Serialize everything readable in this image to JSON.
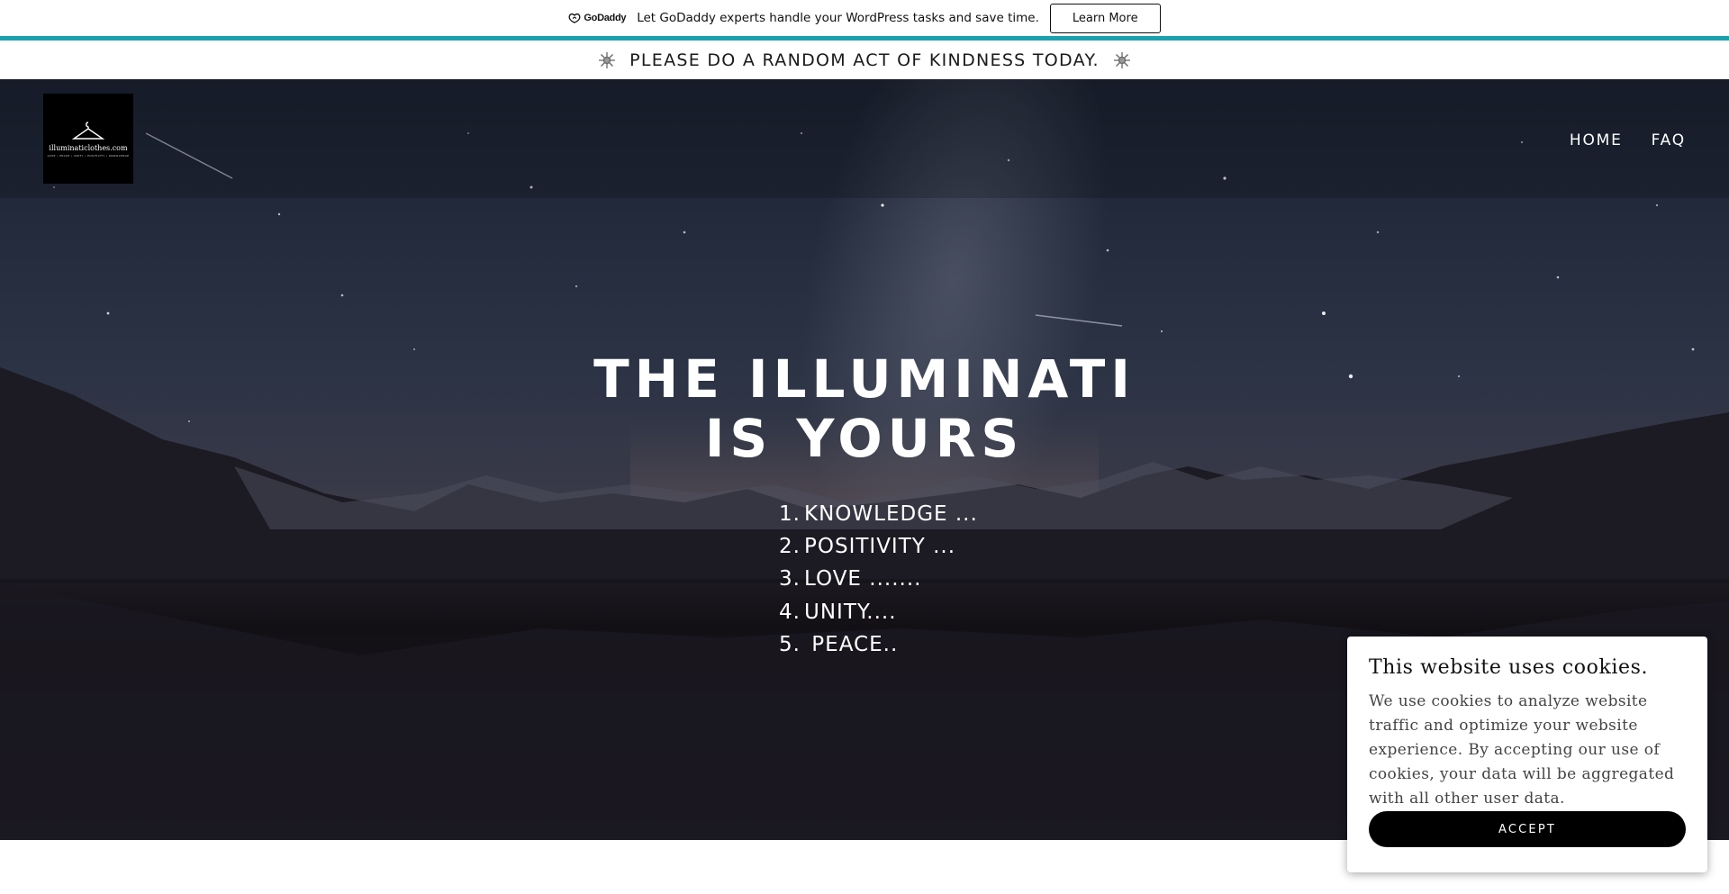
{
  "promo": {
    "logo_text": "GoDaddy",
    "message": "Let GoDaddy experts handle your WordPress tasks and save time.",
    "button_label": "Learn More",
    "accent_color": "#1ba1ad"
  },
  "announcement": {
    "text": "PLEASE DO A RANDOM ACT OF KINDNESS TODAY.",
    "icon": "sparkle-icon"
  },
  "header": {
    "logo_text": "illuminaticlothes.com",
    "logo_tagline": "LOVE • PEACE • UNITY • POSITIVITY • KNOWLEDGE",
    "logo_icon": "clothes-hanger-icon",
    "nav": [
      {
        "label": "HOME"
      },
      {
        "label": "FAQ"
      }
    ]
  },
  "hero": {
    "title_line1": "THE ILLUMINATI",
    "title_line2": "IS YOURS",
    "list": [
      {
        "num": "1.",
        "text": "KNOWLEDGE ..."
      },
      {
        "num": "2.",
        "text": "POSITIVITY ..."
      },
      {
        "num": "3.",
        "text": "LOVE ......."
      },
      {
        "num": "4.",
        "text": "UNITY...."
      },
      {
        "num": "5.",
        "text": " PEACE.."
      }
    ]
  },
  "cookie_banner": {
    "title": "This website uses cookies.",
    "body": "We use cookies to analyze website traffic and optimize your website experience. By accepting our use of cookies, your data will be aggregated with all other user data.",
    "accept_label": "ACCEPT"
  }
}
